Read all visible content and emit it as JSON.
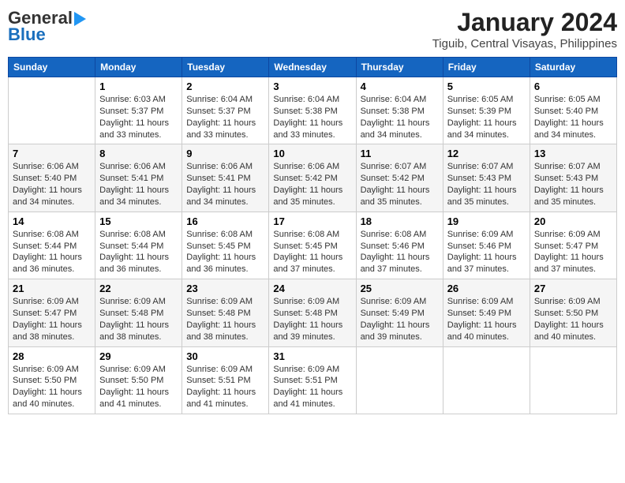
{
  "logo": {
    "general": "General",
    "blue": "Blue"
  },
  "title": "January 2024",
  "subtitle": "Tiguib, Central Visayas, Philippines",
  "days": [
    "Sunday",
    "Monday",
    "Tuesday",
    "Wednesday",
    "Thursday",
    "Friday",
    "Saturday"
  ],
  "weeks": [
    [
      {
        "num": "",
        "sunrise": "",
        "sunset": "",
        "daylight": ""
      },
      {
        "num": "1",
        "sunrise": "Sunrise: 6:03 AM",
        "sunset": "Sunset: 5:37 PM",
        "daylight": "Daylight: 11 hours and 33 minutes."
      },
      {
        "num": "2",
        "sunrise": "Sunrise: 6:04 AM",
        "sunset": "Sunset: 5:37 PM",
        "daylight": "Daylight: 11 hours and 33 minutes."
      },
      {
        "num": "3",
        "sunrise": "Sunrise: 6:04 AM",
        "sunset": "Sunset: 5:38 PM",
        "daylight": "Daylight: 11 hours and 33 minutes."
      },
      {
        "num": "4",
        "sunrise": "Sunrise: 6:04 AM",
        "sunset": "Sunset: 5:38 PM",
        "daylight": "Daylight: 11 hours and 34 minutes."
      },
      {
        "num": "5",
        "sunrise": "Sunrise: 6:05 AM",
        "sunset": "Sunset: 5:39 PM",
        "daylight": "Daylight: 11 hours and 34 minutes."
      },
      {
        "num": "6",
        "sunrise": "Sunrise: 6:05 AM",
        "sunset": "Sunset: 5:40 PM",
        "daylight": "Daylight: 11 hours and 34 minutes."
      }
    ],
    [
      {
        "num": "7",
        "sunrise": "Sunrise: 6:06 AM",
        "sunset": "Sunset: 5:40 PM",
        "daylight": "Daylight: 11 hours and 34 minutes."
      },
      {
        "num": "8",
        "sunrise": "Sunrise: 6:06 AM",
        "sunset": "Sunset: 5:41 PM",
        "daylight": "Daylight: 11 hours and 34 minutes."
      },
      {
        "num": "9",
        "sunrise": "Sunrise: 6:06 AM",
        "sunset": "Sunset: 5:41 PM",
        "daylight": "Daylight: 11 hours and 34 minutes."
      },
      {
        "num": "10",
        "sunrise": "Sunrise: 6:06 AM",
        "sunset": "Sunset: 5:42 PM",
        "daylight": "Daylight: 11 hours and 35 minutes."
      },
      {
        "num": "11",
        "sunrise": "Sunrise: 6:07 AM",
        "sunset": "Sunset: 5:42 PM",
        "daylight": "Daylight: 11 hours and 35 minutes."
      },
      {
        "num": "12",
        "sunrise": "Sunrise: 6:07 AM",
        "sunset": "Sunset: 5:43 PM",
        "daylight": "Daylight: 11 hours and 35 minutes."
      },
      {
        "num": "13",
        "sunrise": "Sunrise: 6:07 AM",
        "sunset": "Sunset: 5:43 PM",
        "daylight": "Daylight: 11 hours and 35 minutes."
      }
    ],
    [
      {
        "num": "14",
        "sunrise": "Sunrise: 6:08 AM",
        "sunset": "Sunset: 5:44 PM",
        "daylight": "Daylight: 11 hours and 36 minutes."
      },
      {
        "num": "15",
        "sunrise": "Sunrise: 6:08 AM",
        "sunset": "Sunset: 5:44 PM",
        "daylight": "Daylight: 11 hours and 36 minutes."
      },
      {
        "num": "16",
        "sunrise": "Sunrise: 6:08 AM",
        "sunset": "Sunset: 5:45 PM",
        "daylight": "Daylight: 11 hours and 36 minutes."
      },
      {
        "num": "17",
        "sunrise": "Sunrise: 6:08 AM",
        "sunset": "Sunset: 5:45 PM",
        "daylight": "Daylight: 11 hours and 37 minutes."
      },
      {
        "num": "18",
        "sunrise": "Sunrise: 6:08 AM",
        "sunset": "Sunset: 5:46 PM",
        "daylight": "Daylight: 11 hours and 37 minutes."
      },
      {
        "num": "19",
        "sunrise": "Sunrise: 6:09 AM",
        "sunset": "Sunset: 5:46 PM",
        "daylight": "Daylight: 11 hours and 37 minutes."
      },
      {
        "num": "20",
        "sunrise": "Sunrise: 6:09 AM",
        "sunset": "Sunset: 5:47 PM",
        "daylight": "Daylight: 11 hours and 37 minutes."
      }
    ],
    [
      {
        "num": "21",
        "sunrise": "Sunrise: 6:09 AM",
        "sunset": "Sunset: 5:47 PM",
        "daylight": "Daylight: 11 hours and 38 minutes."
      },
      {
        "num": "22",
        "sunrise": "Sunrise: 6:09 AM",
        "sunset": "Sunset: 5:48 PM",
        "daylight": "Daylight: 11 hours and 38 minutes."
      },
      {
        "num": "23",
        "sunrise": "Sunrise: 6:09 AM",
        "sunset": "Sunset: 5:48 PM",
        "daylight": "Daylight: 11 hours and 38 minutes."
      },
      {
        "num": "24",
        "sunrise": "Sunrise: 6:09 AM",
        "sunset": "Sunset: 5:48 PM",
        "daylight": "Daylight: 11 hours and 39 minutes."
      },
      {
        "num": "25",
        "sunrise": "Sunrise: 6:09 AM",
        "sunset": "Sunset: 5:49 PM",
        "daylight": "Daylight: 11 hours and 39 minutes."
      },
      {
        "num": "26",
        "sunrise": "Sunrise: 6:09 AM",
        "sunset": "Sunset: 5:49 PM",
        "daylight": "Daylight: 11 hours and 40 minutes."
      },
      {
        "num": "27",
        "sunrise": "Sunrise: 6:09 AM",
        "sunset": "Sunset: 5:50 PM",
        "daylight": "Daylight: 11 hours and 40 minutes."
      }
    ],
    [
      {
        "num": "28",
        "sunrise": "Sunrise: 6:09 AM",
        "sunset": "Sunset: 5:50 PM",
        "daylight": "Daylight: 11 hours and 40 minutes."
      },
      {
        "num": "29",
        "sunrise": "Sunrise: 6:09 AM",
        "sunset": "Sunset: 5:50 PM",
        "daylight": "Daylight: 11 hours and 41 minutes."
      },
      {
        "num": "30",
        "sunrise": "Sunrise: 6:09 AM",
        "sunset": "Sunset: 5:51 PM",
        "daylight": "Daylight: 11 hours and 41 minutes."
      },
      {
        "num": "31",
        "sunrise": "Sunrise: 6:09 AM",
        "sunset": "Sunset: 5:51 PM",
        "daylight": "Daylight: 11 hours and 41 minutes."
      },
      {
        "num": "",
        "sunrise": "",
        "sunset": "",
        "daylight": ""
      },
      {
        "num": "",
        "sunrise": "",
        "sunset": "",
        "daylight": ""
      },
      {
        "num": "",
        "sunrise": "",
        "sunset": "",
        "daylight": ""
      }
    ]
  ]
}
